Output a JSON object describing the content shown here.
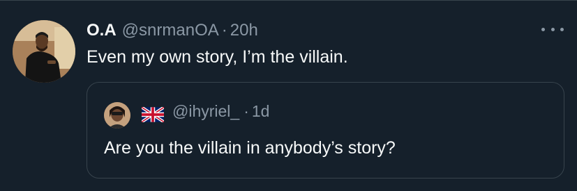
{
  "tweet": {
    "display_name": "O.A",
    "handle": "@snrmanOA",
    "separator": "·",
    "time": "20h",
    "text": "Even my own story, I’m the villain."
  },
  "quoted_tweet": {
    "flag_icon": "uk-flag-icon",
    "handle": "@ihyriel_",
    "separator": "·",
    "time": "1d",
    "text": "Are you the villain in anybody’s story?"
  },
  "colors": {
    "background": "#15202b",
    "primary_text": "#f7f9f9",
    "secondary_text": "#8b98a5",
    "border": "#38444d"
  }
}
